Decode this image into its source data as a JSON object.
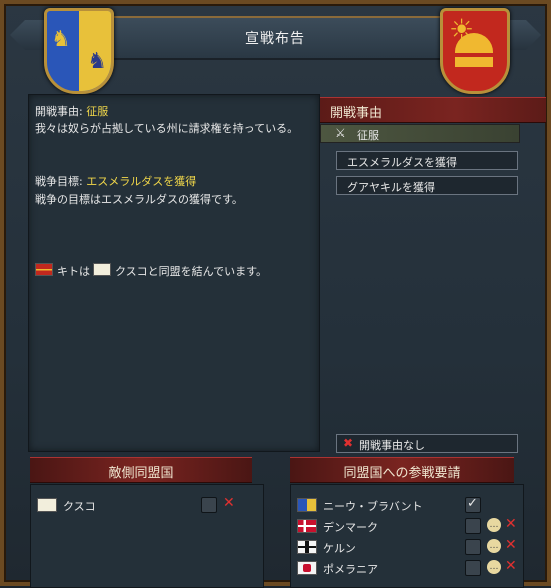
{
  "window": {
    "title": "宣戦布告"
  },
  "description": {
    "cb_label": "開戦事由:",
    "cb_value": "征服",
    "claim_text": "我々は奴らが占拠している州に請求権を持っている。",
    "goal_label": "戦争目標:",
    "goal_value": "エスメラルダスを獲得",
    "goal_desc": "戦争の目標はエスメラルダスの獲得です。",
    "alliance_part1": "キトは",
    "alliance_part2": "クスコと同盟を結んでいます。"
  },
  "casus_belli": {
    "header": "開戦事由",
    "selected": "征服",
    "goals": [
      "エスメラルダスを獲得",
      "グアヤキルを獲得"
    ],
    "none_label": "開戦事由なし"
  },
  "enemy_allies": {
    "header": "敵側同盟国",
    "rows": [
      {
        "name": "クスコ"
      }
    ]
  },
  "ally_requests": {
    "header": "同盟国への参戦要請",
    "rows": [
      {
        "name": "ニーウ・ブラバント",
        "checked": true
      },
      {
        "name": "デンマーク",
        "checked": false
      },
      {
        "name": "ケルン",
        "checked": false
      },
      {
        "name": "ポメラニア",
        "checked": false
      }
    ]
  },
  "colors": {
    "accent_red": "#7a2420",
    "highlight_yellow": "#f2d84a",
    "cancel_red": "#e03030"
  }
}
